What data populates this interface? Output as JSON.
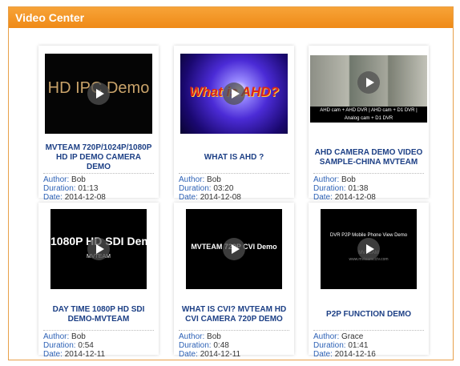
{
  "header": {
    "title": "Video Center"
  },
  "labels": {
    "author": "Author:",
    "duration": "Duration:",
    "date": "Date:"
  },
  "videos": [
    {
      "title": "MVTEAM 720P/1024P/1080P HD IP DEMO CAMERA DEMO",
      "thumb_text": "HD IPC Demo",
      "author": "Bob",
      "duration": "01:13",
      "date": "2014-12-08"
    },
    {
      "title": "WHAT IS AHD ?",
      "thumb_text": "What is AHD?",
      "author": "Bob",
      "duration": "03:20",
      "date": "2014-12-08"
    },
    {
      "title": "AHD CAMERA DEMO VIDEO SAMPLE-CHINA MVTEAM",
      "thumb_text": "AHD cam + AHD DVR  |  AHD cam + D1 DVR  |  Analog cam + D1 DVR",
      "author": "Bob",
      "duration": "01:38",
      "date": "2014-12-08"
    },
    {
      "title": "DAY TIME 1080P HD SDI DEMO-MVTEAM",
      "thumb_text": "1080P HD SDI Demo",
      "thumb_sub": "MVTEAM",
      "author": "Bob",
      "duration": "0:54",
      "date": "2014-12-11"
    },
    {
      "title": "WHAT IS CVI? MVTEAM HD CVI CAMERA 720P DEMO",
      "thumb_text": "MVTEAM 720P CVI Demo",
      "author": "Bob",
      "duration": "0:48",
      "date": "2014-12-11"
    },
    {
      "title": "P2P FUNCTION DEMO",
      "thumb_text": "DVR P2P Mobile Phone View Demo",
      "thumb_sub": "MVTEAM",
      "thumb_sub2": "www.mvteamcctv.com",
      "author": "Grace",
      "duration": "01:41",
      "date": "2014-12-16"
    }
  ]
}
